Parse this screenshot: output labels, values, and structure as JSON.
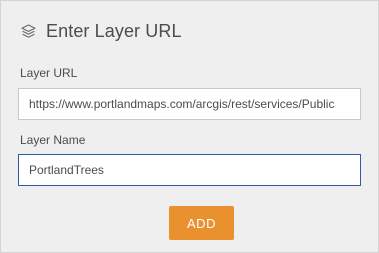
{
  "dialog": {
    "title": "Enter Layer URL",
    "icon": "layers-icon"
  },
  "layer_url": {
    "label": "Layer URL",
    "value": "https://www.portlandmaps.com/arcgis/rest/services/Public"
  },
  "layer_name": {
    "label": "Layer Name",
    "value": "PortlandTrees"
  },
  "actions": {
    "add_label": "ADD"
  },
  "colors": {
    "accent": "#e8912e",
    "focus_border": "#2a5da3",
    "panel_bg": "#efefef",
    "text": "#4c4c4c"
  }
}
